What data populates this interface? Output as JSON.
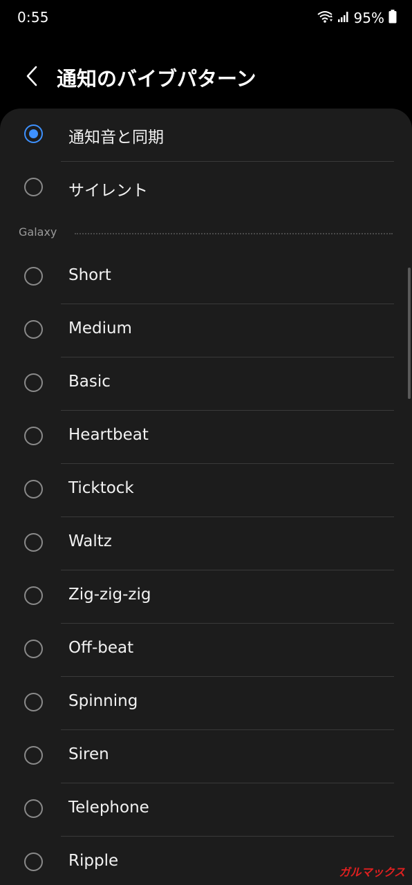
{
  "status_bar": {
    "time": "0:55",
    "battery_percent": "95%",
    "icons": [
      "wifi-icon",
      "signal-icon",
      "battery-icon"
    ]
  },
  "header": {
    "back_icon": "chevron-left-icon",
    "title": "通知のバイブパターン"
  },
  "options_top": [
    {
      "label": "通知音と同期",
      "selected": true
    },
    {
      "label": "サイレント",
      "selected": false
    }
  ],
  "section": {
    "title": "Galaxy"
  },
  "options_galaxy": [
    {
      "label": "Short",
      "selected": false
    },
    {
      "label": "Medium",
      "selected": false
    },
    {
      "label": "Basic",
      "selected": false
    },
    {
      "label": "Heartbeat",
      "selected": false
    },
    {
      "label": "Ticktock",
      "selected": false
    },
    {
      "label": "Waltz",
      "selected": false
    },
    {
      "label": "Zig-zig-zig",
      "selected": false
    },
    {
      "label": "Off-beat",
      "selected": false
    },
    {
      "label": "Spinning",
      "selected": false
    },
    {
      "label": "Siren",
      "selected": false
    },
    {
      "label": "Telephone",
      "selected": false
    },
    {
      "label": "Ripple",
      "selected": false
    }
  ],
  "watermark": "ガルマックス",
  "colors": {
    "accent": "#3e91ff",
    "background": "#000000",
    "card": "#1c1c1c",
    "watermark": "#e02020"
  }
}
